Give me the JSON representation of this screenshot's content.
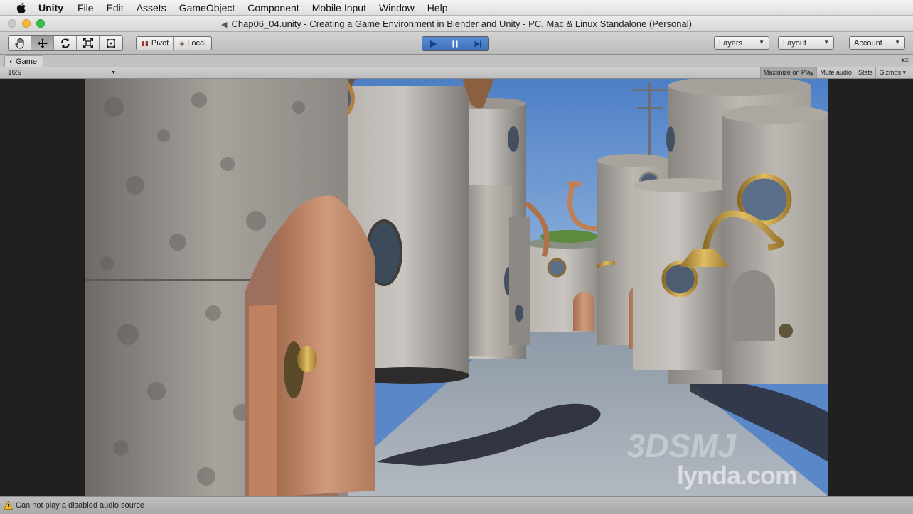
{
  "menubar": {
    "app_name": "Unity",
    "items": [
      "File",
      "Edit",
      "Assets",
      "GameObject",
      "Component",
      "Mobile Input",
      "Window",
      "Help"
    ]
  },
  "window": {
    "title": "Chap06_04.unity - Creating a Game Environment in Blender and Unity - PC, Mac & Linux Standalone (Personal)"
  },
  "toolbar": {
    "tools": [
      "hand-tool",
      "move-tool",
      "rotate-tool",
      "scale-tool",
      "rect-tool"
    ],
    "pivot_label": "Pivot",
    "local_label": "Local",
    "layers_label": "Layers",
    "layout_label": "Layout",
    "account_label": "Account"
  },
  "game_view": {
    "tab_label": "Game",
    "aspect": "16:9",
    "buttons": [
      "Maximize on Play",
      "Mute audio",
      "Stats",
      "Gizmos"
    ]
  },
  "watermark": {
    "brand": "lynda.com",
    "site": "3DSMJ"
  },
  "status": {
    "message": "Can not play a disabled audio source"
  },
  "colors": {
    "play_accent": "#3c6fbd",
    "sky": "#5a87c8",
    "stone": "#9a9590",
    "door_wood": "#c48a6a",
    "brass": "#c7a04a"
  }
}
